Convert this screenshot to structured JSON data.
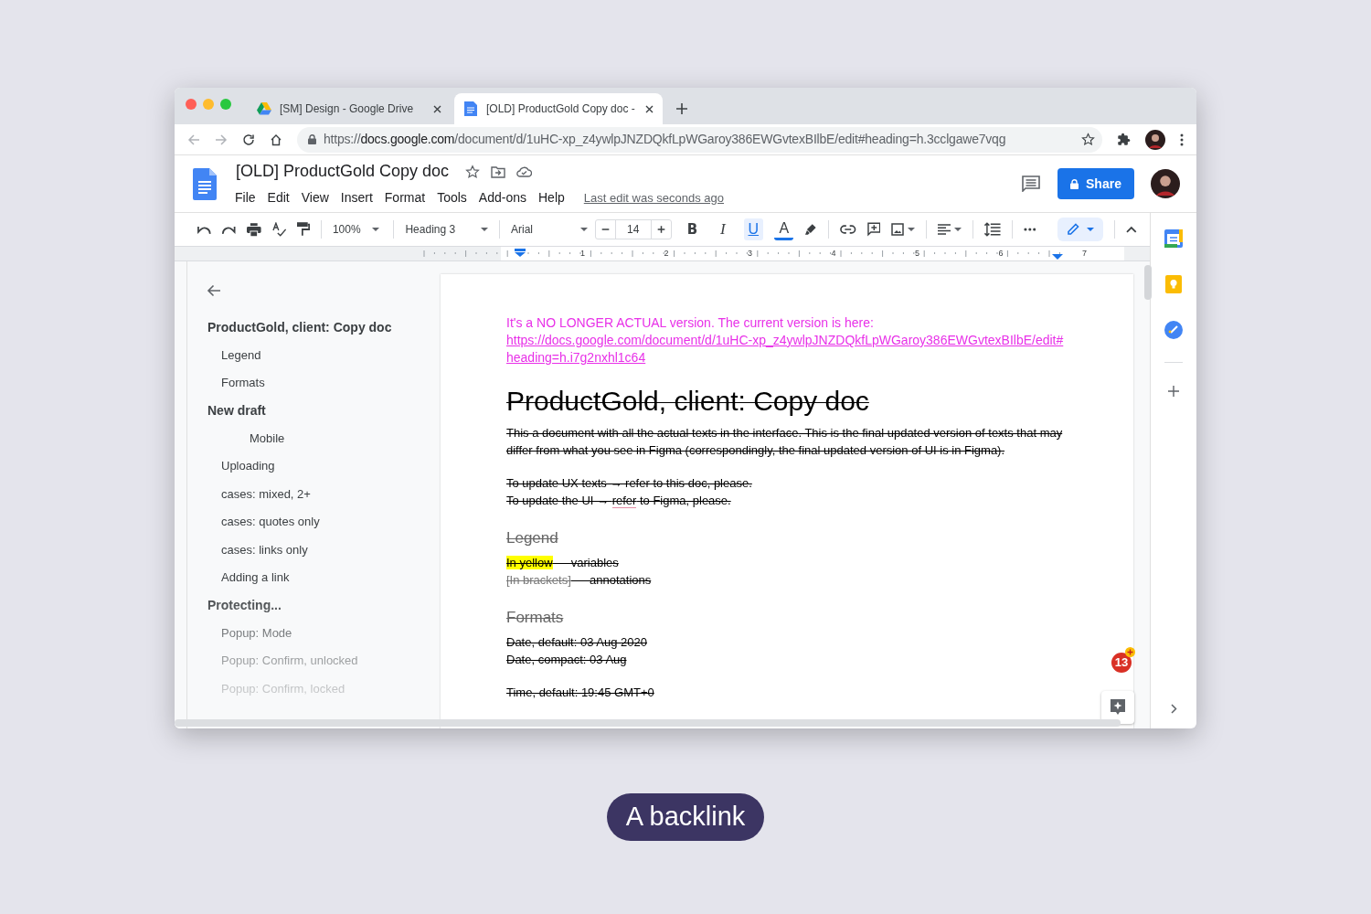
{
  "browser": {
    "tabs": [
      {
        "title": "[SM] Design - Google Drive",
        "selected": false
      },
      {
        "title": "[OLD] ProductGold Copy doc -",
        "selected": true
      }
    ],
    "url_host": "https://docs.google.com",
    "url_path": "/document/d/1uHC-xp_z4ywlpJNZDQkfLpWGaroy386EWGvtexBIlbE/edit#heading=h.3cclgawe7vqg"
  },
  "doc_header": {
    "title": "[OLD] ProductGold Copy doc",
    "menu": [
      "File",
      "Edit",
      "View",
      "Insert",
      "Format",
      "Tools",
      "Add-ons",
      "Help"
    ],
    "last_edit": "Last edit was seconds ago",
    "share": "Share"
  },
  "toolbar": {
    "zoom": "100%",
    "style": "Heading 3",
    "font": "Arial",
    "size": "14",
    "format_buttons": [
      {
        "label": "B",
        "kind": "bold",
        "selected": false
      },
      {
        "label": "I",
        "kind": "italic",
        "selected": false
      },
      {
        "label": "U",
        "kind": "underline",
        "selected": true
      },
      {
        "label": "A",
        "kind": "color",
        "selected": false
      }
    ]
  },
  "ruler": [
    "1",
    "2",
    "3",
    "4",
    "5",
    "6",
    "7"
  ],
  "outline": [
    {
      "label": "ProductGold, client: Copy doc",
      "kind": "major",
      "children": [
        {
          "label": "Legend",
          "kind": "minor"
        },
        {
          "label": "Formats",
          "kind": "minor"
        }
      ]
    },
    {
      "label": "New draft",
      "kind": "major",
      "children": [
        {
          "label": "Mobile",
          "kind": "deep"
        },
        {
          "label": "Uploading",
          "kind": "minor"
        },
        {
          "label": "cases: mixed, 2+",
          "kind": "minor"
        },
        {
          "label": "cases: quotes only",
          "kind": "minor"
        },
        {
          "label": "cases: links only",
          "kind": "minor"
        },
        {
          "label": "Adding a link",
          "kind": "minor"
        }
      ]
    },
    {
      "label": "Protecting...",
      "kind": "major",
      "children": [
        {
          "label": "Popup: Mode",
          "kind": "minor"
        },
        {
          "label": "Popup: Confirm, unlocked",
          "kind": "minor"
        },
        {
          "label": "Popup: Confirm, locked",
          "kind": "minor"
        }
      ]
    }
  ],
  "document": [
    {
      "kind": "notice",
      "text": "It's a NO LONGER ACTUAL version. The current version is here:",
      "strikethrough": false
    },
    {
      "kind": "link",
      "text": "https://docs.google.com/document/d/1uHC-xp_z4ywlpJNZDQkfLpWGaroy386EWGvtexBIlbE/edit#heading=h.i7g2nxhl1c64",
      "strikethrough": false
    },
    {
      "kind": "title",
      "text": "ProductGold, client: Copy doc",
      "strikethrough": true
    },
    {
      "kind": "paragraph",
      "text": "This a document with all the actual texts in the interface. This is the final updated version of texts that may differ from what you see in Figma (correspondingly, the final updated version of UI is in Figma).",
      "strikethrough": true
    },
    {
      "kind": "gap"
    },
    {
      "kind": "line",
      "parts": [
        {
          "text": "To update UX texts → refer to this doc, please.",
          "kind": "plain"
        }
      ],
      "strikethrough": true
    },
    {
      "kind": "line",
      "parts": [
        {
          "text": "To update the UI → ",
          "kind": "plain"
        },
        {
          "text": "refer",
          "kind": "misspelled"
        },
        {
          "text": " to Figma, please.",
          "kind": "plain"
        }
      ],
      "strikethrough": true
    },
    {
      "kind": "heading",
      "text": "Legend",
      "strikethrough": true
    },
    {
      "kind": "line",
      "parts": [
        {
          "text": "In yellow",
          "kind": "variable"
        },
        {
          "text": " — variables",
          "kind": "plain"
        }
      ],
      "strikethrough": true
    },
    {
      "kind": "line",
      "parts": [
        {
          "text": "[In brackets]",
          "kind": "annotation"
        },
        {
          "text": " — annotations",
          "kind": "plain"
        }
      ],
      "strikethrough": true
    },
    {
      "kind": "heading",
      "text": "Formats",
      "strikethrough": true
    },
    {
      "kind": "line",
      "parts": [
        {
          "text": "Date, default: 03 Aug 2020",
          "kind": "plain"
        }
      ],
      "strikethrough": true
    },
    {
      "kind": "line",
      "parts": [
        {
          "text": "Date, compact: 03 Aug",
          "kind": "plain"
        }
      ],
      "strikethrough": true
    },
    {
      "kind": "gap"
    },
    {
      "kind": "line",
      "parts": [
        {
          "text": "Time, default: 19:45 GMT+0",
          "kind": "plain"
        }
      ],
      "strikethrough": true
    }
  ],
  "comments_badge": "13",
  "caption": "A backlink"
}
